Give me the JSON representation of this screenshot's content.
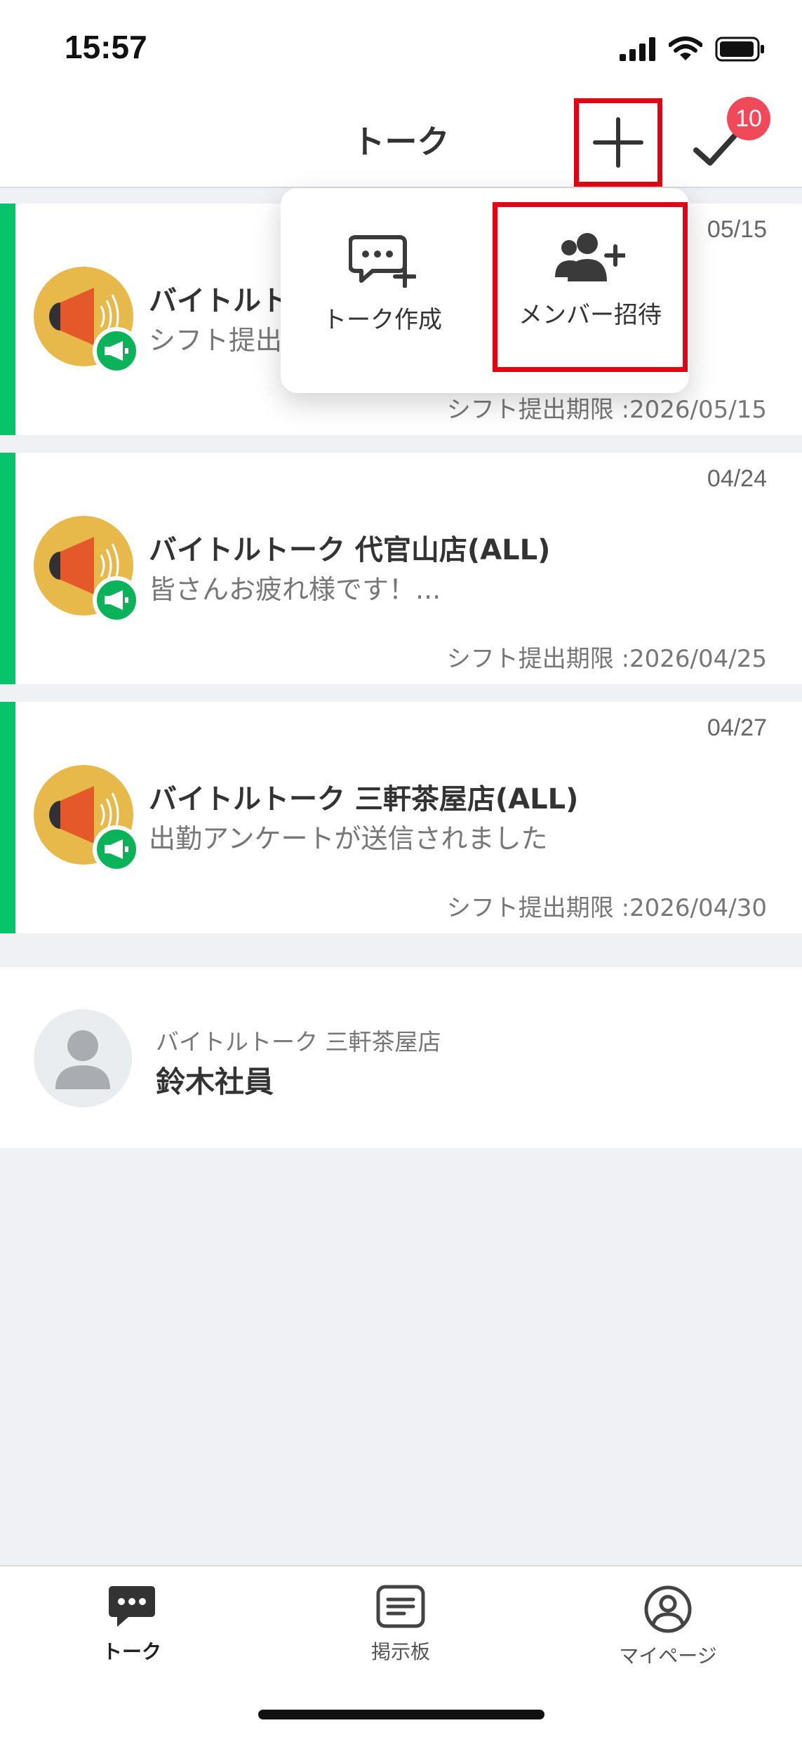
{
  "status_bar": {
    "time": "15:57"
  },
  "header": {
    "title": "トーク",
    "badge_count": "10"
  },
  "popup": {
    "create_label": "トーク作成",
    "invite_label": "メンバー招待"
  },
  "talks": [
    {
      "date": "05/15",
      "title": "バイトルトーク 恵比寿店(ALL)",
      "title_visible": "バイトルト",
      "message": "シフト提出",
      "deadline": "シフト提出期限 :2026/05/15"
    },
    {
      "date": "04/24",
      "title": "バイトルトーク 代官山店(ALL)",
      "title_visible": "バイトルトーク 代官山店(ALL)",
      "message": "皆さんお疲れ様です！...",
      "deadline": "シフト提出期限 :2026/04/25"
    },
    {
      "date": "04/27",
      "title": "バイトルトーク 三軒茶屋店(ALL)",
      "title_visible": "バイトルトーク 三軒茶屋店(ALL)",
      "message": "出勤アンケートが送信されました",
      "deadline": "シフト提出期限 :2026/04/30"
    }
  ],
  "member": {
    "store": "バイトルトーク 三軒茶屋店",
    "name": "鈴木社員"
  },
  "tabs": [
    {
      "label": "トーク",
      "icon": "chat-icon"
    },
    {
      "label": "掲示板",
      "icon": "board-icon"
    },
    {
      "label": "マイページ",
      "icon": "profile-icon"
    }
  ],
  "colors": {
    "accent_green": "#07c46a",
    "highlight_red": "#e60012",
    "badge_red": "#f04a5a",
    "avatar_yellow": "#e7b94a"
  }
}
